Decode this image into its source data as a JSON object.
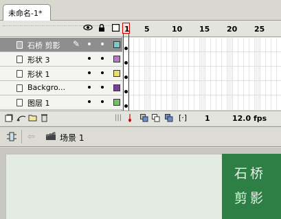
{
  "document_tab": {
    "title": "未命名-1*"
  },
  "timeline": {
    "header_icons": [
      "eye-icon",
      "lock-icon",
      "outline-icon"
    ],
    "frame_numbers": [
      "1",
      "5",
      "10",
      "15",
      "20",
      "25"
    ],
    "layers": [
      {
        "name": "石桥 剪影",
        "selected": true,
        "color": "#7ec8c8"
      },
      {
        "name": "形状 3",
        "selected": false,
        "color": "#b47cc0"
      },
      {
        "name": "形状 1",
        "selected": false,
        "color": "#e6e06a"
      },
      {
        "name": "Backgro...",
        "selected": false,
        "color": "#7a3f9a"
      },
      {
        "name": "图层 1",
        "selected": false,
        "color": "#6fbf6f"
      }
    ],
    "current_frame": "1",
    "frame_rate": "12.0 fps"
  },
  "edit_bar": {
    "scene_label": "场景 1"
  },
  "stage": {
    "artwork_text_line1": "石桥",
    "artwork_text_line2": "剪影",
    "artwork_bg": "#2e7f45"
  }
}
